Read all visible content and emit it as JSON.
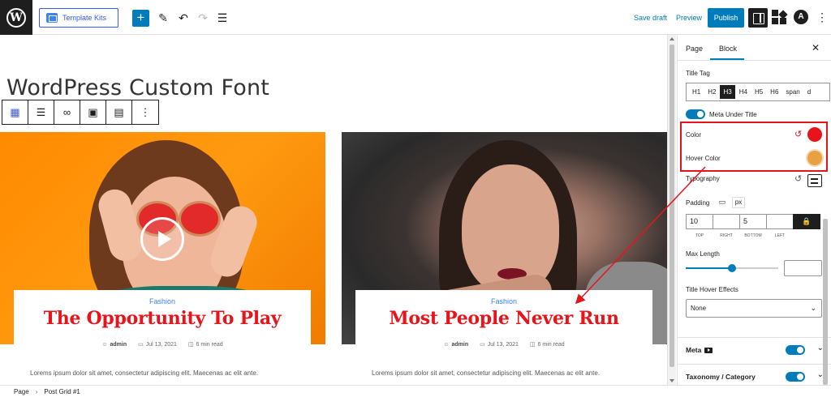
{
  "topbar": {
    "template_kits_label": "Template Kits",
    "add_icon": "plus-icon",
    "tools": [
      "pencil-icon",
      "undo-icon",
      "redo-icon",
      "list-view-icon"
    ],
    "save_draft_label": "Save draft",
    "preview_label": "Preview",
    "publish_label": "Publish"
  },
  "canvas": {
    "page_title": "WordPress Custom Font",
    "block_toolbar": [
      "grid-icon",
      "align-icon",
      "link-icon",
      "image-icon",
      "layout-icon",
      "more-icon"
    ],
    "posts": [
      {
        "category": "Fashion",
        "title": "The Opportunity To Play",
        "author": "admin",
        "date": "Jul 13, 2021",
        "read_time": "6 min read",
        "excerpt": "Lorems ipsum dolor sit amet, consectetur adipiscing elit. Maecenas ac elit ante."
      },
      {
        "category": "Fashion",
        "title": "Most People Never Run",
        "author": "admin",
        "date": "Jul 13, 2021",
        "read_time": "6 min read",
        "excerpt": "Lorems ipsum dolor sit amet, consectetur adipiscing elit. Maecenas ac elit ante."
      }
    ]
  },
  "sidebar": {
    "tabs": [
      "Page",
      "Block"
    ],
    "active_tab": "Block",
    "title_tag_label": "Title Tag",
    "title_tags": [
      "H1",
      "H2",
      "H3",
      "H4",
      "H5",
      "H6",
      "span",
      "d"
    ],
    "title_tag_selected": "H3",
    "meta_under_title_label": "Meta Under Title",
    "color_label": "Color",
    "hover_color_label": "Hover Color",
    "color_value": "#e8141c",
    "hover_color_value": "#e8a040",
    "typography_label": "Typography",
    "padding_label": "Padding",
    "padding_unit": "px",
    "padding_values": [
      "10",
      "",
      "5",
      ""
    ],
    "padding_sides": [
      "TOP",
      "RIGHT",
      "BOTTOM",
      "LEFT"
    ],
    "max_length_label": "Max Length",
    "max_length_level": 0.5,
    "title_hover_effects_label": "Title Hover Effects",
    "title_hover_effects_value": "None",
    "panels": [
      {
        "title": "Meta",
        "icon": "youtube-icon"
      },
      {
        "title": "Taxonomy / Category",
        "icon": ""
      }
    ]
  },
  "footer": {
    "breadcrumb": [
      "Page",
      "Post Grid #1"
    ]
  },
  "colors": {
    "accent": "#007cba",
    "title_red": "#e8141c",
    "category_blue": "#3b82f6"
  }
}
